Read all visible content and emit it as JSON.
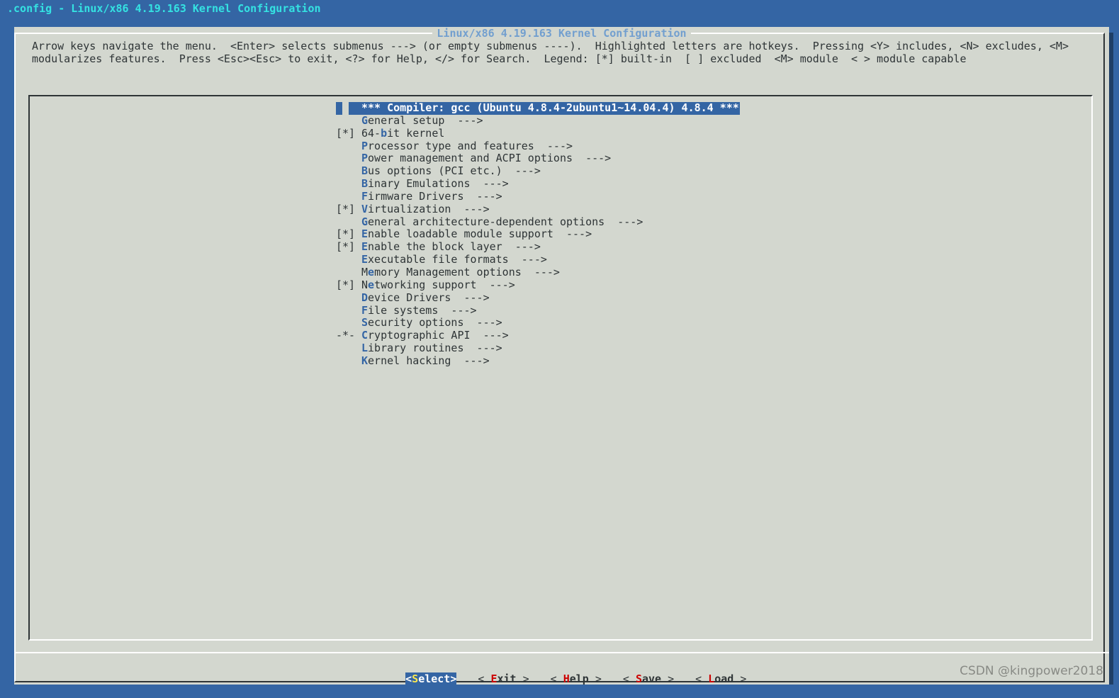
{
  "window": {
    "title": ".config - Linux/x86 4.19.163 Kernel Configuration"
  },
  "dialog": {
    "title": "Linux/x86 4.19.163 Kernel Configuration",
    "help_line1": "Arrow keys navigate the menu.  <Enter> selects submenus ---> (or empty submenus ----).  Highlighted letters are hotkeys.  Pressing <Y> includes, <N> excludes, <M>",
    "help_line2": "modularizes features.  Press <Esc><Esc> to exit, <?> for Help, </> for Search.  Legend: [*] built-in  [ ] excluded  <M> module  < > module capable"
  },
  "menu": {
    "items": [
      {
        "state": "    ",
        "pre": "",
        "hk": "",
        "post": "*** Compiler: gcc (Ubuntu 4.8.4-2ubuntu1~14.04.4) 4.8.4 ***",
        "selected": true
      },
      {
        "state": "    ",
        "pre": "",
        "hk": "G",
        "post": "eneral setup  --->"
      },
      {
        "state": "[*] ",
        "pre": "64-",
        "hk": "b",
        "post": "it kernel"
      },
      {
        "state": "    ",
        "pre": "",
        "hk": "P",
        "post": "rocessor type and features  --->"
      },
      {
        "state": "    ",
        "pre": "",
        "hk": "P",
        "post": "ower management and ACPI options  --->"
      },
      {
        "state": "    ",
        "pre": "",
        "hk": "B",
        "post": "us options (PCI etc.)  --->"
      },
      {
        "state": "    ",
        "pre": "",
        "hk": "B",
        "post": "inary Emulations  --->"
      },
      {
        "state": "    ",
        "pre": "",
        "hk": "F",
        "post": "irmware Drivers  --->"
      },
      {
        "state": "[*] ",
        "pre": "",
        "hk": "V",
        "post": "irtualization  --->"
      },
      {
        "state": "    ",
        "pre": "",
        "hk": "G",
        "post": "eneral architecture-dependent options  --->"
      },
      {
        "state": "[*] ",
        "pre": "",
        "hk": "E",
        "post": "nable loadable module support  --->"
      },
      {
        "state": "[*] ",
        "pre": "",
        "hk": "E",
        "post": "nable the block layer  --->"
      },
      {
        "state": "    ",
        "pre": "",
        "hk": "E",
        "post": "xecutable file formats  --->"
      },
      {
        "state": "    ",
        "pre": "M",
        "hk": "e",
        "post": "mory Management options  --->"
      },
      {
        "state": "[*] ",
        "pre": "N",
        "hk": "e",
        "post": "tworking support  --->"
      },
      {
        "state": "    ",
        "pre": "",
        "hk": "D",
        "post": "evice Drivers  --->"
      },
      {
        "state": "    ",
        "pre": "",
        "hk": "F",
        "post": "ile systems  --->"
      },
      {
        "state": "    ",
        "pre": "",
        "hk": "S",
        "post": "ecurity options  --->"
      },
      {
        "state": "-*- ",
        "pre": "",
        "hk": "C",
        "post": "ryptographic API  --->"
      },
      {
        "state": "    ",
        "pre": "",
        "hk": "L",
        "post": "ibrary routines  --->"
      },
      {
        "state": "    ",
        "pre": "",
        "hk": "K",
        "post": "ernel hacking  --->"
      }
    ]
  },
  "buttons": {
    "select": {
      "open": "<",
      "hk": "S",
      "rest": "elect",
      "close": ">"
    },
    "exit": {
      "open": "< ",
      "hk": "E",
      "rest": "xit",
      "close": " >"
    },
    "help": {
      "open": "< ",
      "hk": "H",
      "rest": "elp",
      "close": " >"
    },
    "save": {
      "open": "< ",
      "hk": "S",
      "rest": "ave",
      "close": " >"
    },
    "load": {
      "open": "< ",
      "hk": "L",
      "rest": "oad",
      "close": " >"
    }
  },
  "watermark": "CSDN @kingpower2018",
  "colors": {
    "background": "#3465a4",
    "dialog": "#d3d7cf",
    "highlight": "#3465a4",
    "hotkey_menu": "#3465a4",
    "hotkey_button": "#cc0000",
    "title_text": "#34e2e2"
  }
}
